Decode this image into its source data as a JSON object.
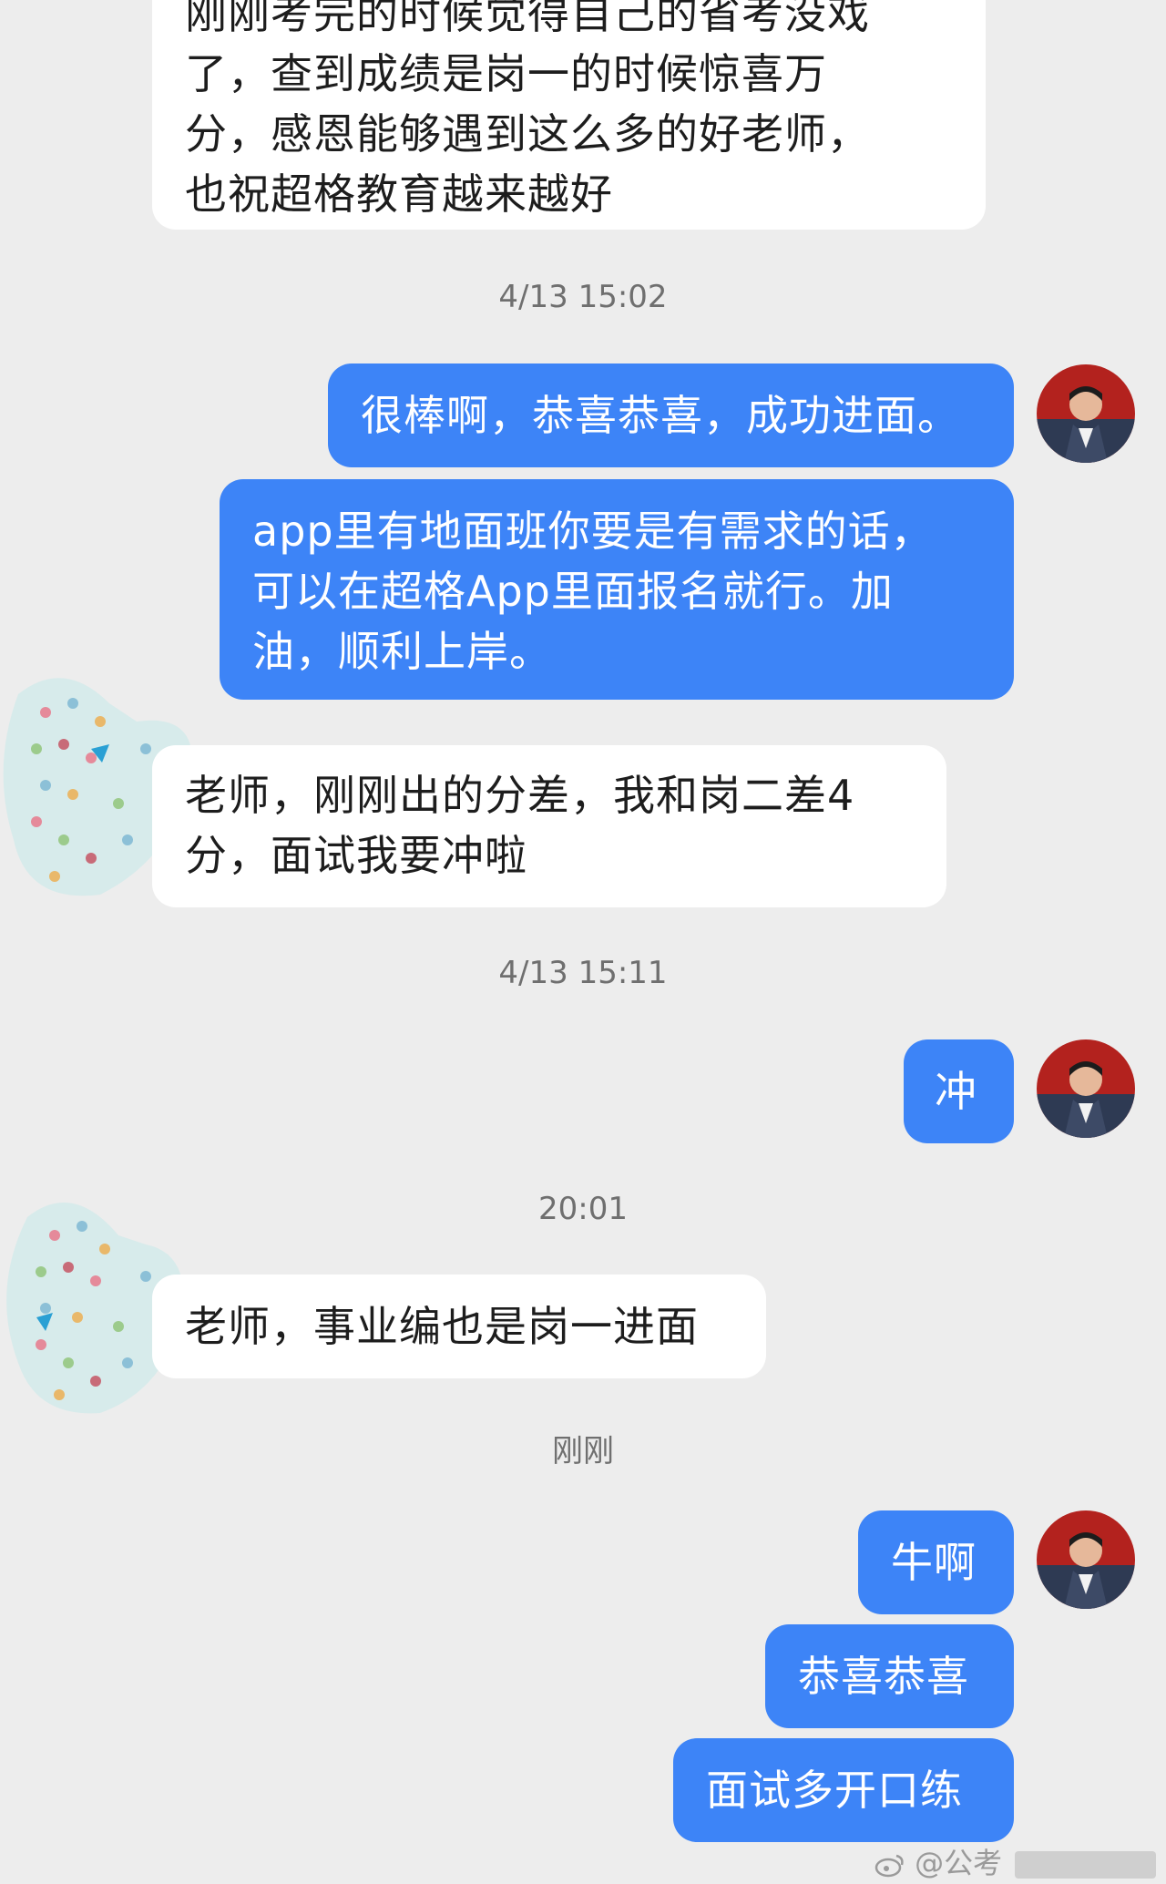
{
  "messages": {
    "m1": "刚刚考完的时候觉得自己的省考没戏\n了，查到成绩是岗一的时候惊喜万\n分，感恩能够遇到这么多的好老师，\n也祝超格教育越来越好",
    "ts1": "4/13 15:02",
    "m2": "很棒啊，恭喜恭喜，成功进面。",
    "m3": "app里有地面班你要是有需求的话，\n可以在超格App里面报名就行。加\n油，顺利上岸。",
    "m4": "老师，刚刚出的分差，我和岗二差4\n分，面试我要冲啦",
    "ts2": "4/13 15:11",
    "m5": "冲",
    "ts3": "20:01",
    "m6": "老师，事业编也是岗一进面",
    "ts4": "刚刚",
    "m7": "牛啊",
    "m8": "恭喜恭喜",
    "m9": "面试多开口练"
  },
  "watermark": "@公考",
  "icons": {
    "weibo": "weibo-icon"
  }
}
